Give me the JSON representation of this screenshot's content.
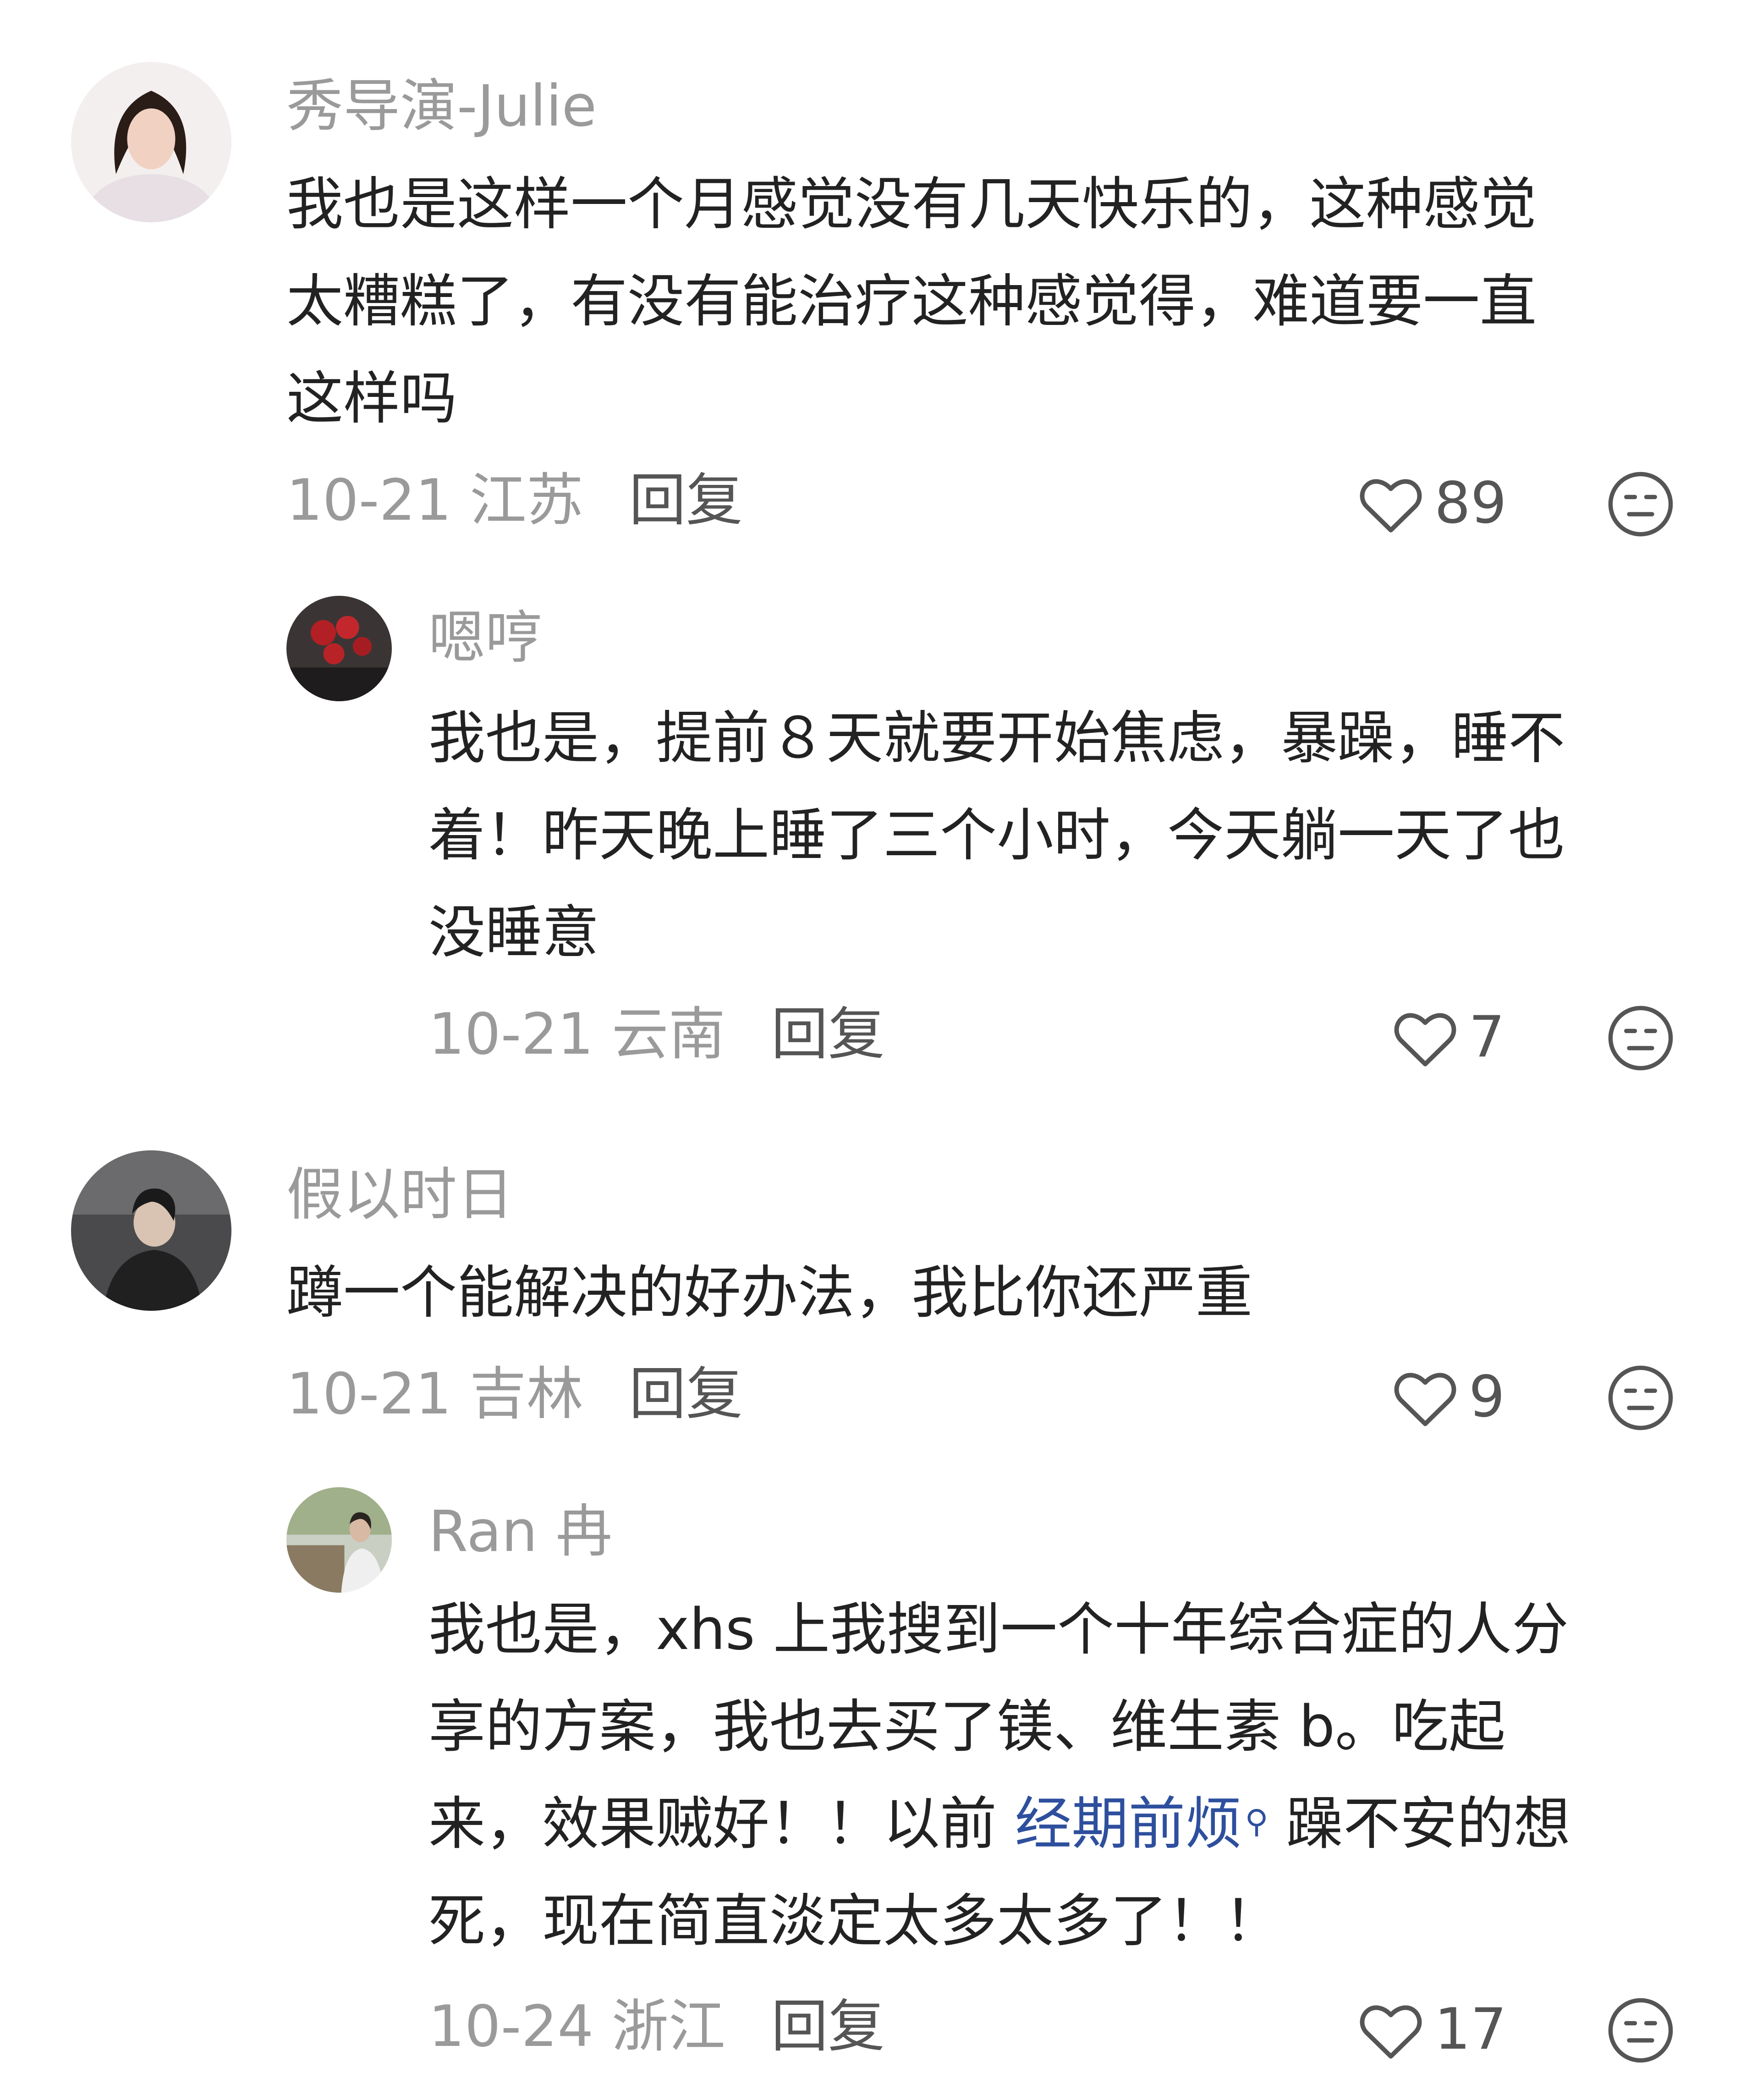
{
  "comments": [
    {
      "author": "秀导演-Julie",
      "lines": [
        "我也是这样一个月感觉没有几天快乐的，这种感觉",
        "太糟糕了，有没有能治疗这种感觉得，难道要一直",
        "这样吗"
      ],
      "date": "10-21 江苏",
      "reply": "回复",
      "likes": "89"
    },
    {
      "author": "嗯哼",
      "lines": [
        "我也是，提前８天就要开始焦虑，暴躁，睡不",
        "着！昨天晚上睡了三个小时，今天躺一天了也",
        "没睡意"
      ],
      "date": "10-21 云南",
      "reply": "回复",
      "likes": "7"
    },
    {
      "author": "假以时日",
      "lines": [
        "蹲一个能解决的好办法，我比你还严重"
      ],
      "date": "10-21 吉林",
      "reply": "回复",
      "likes": "9"
    },
    {
      "author": "Ran 冉",
      "lines": [
        "我也是，xhs 上我搜到一个十年综合症的人分",
        "享的方案，我也去买了镁、维生素 b。吃起"
      ],
      "line3_before": "来，效果贼好！！以前 ",
      "topic": "经期前烦",
      "line3_after": " 躁不安的想",
      "line4": "死，现在简直淡定太多太多了！！",
      "date": "10-24 浙江",
      "reply": "回复",
      "likes": "17"
    }
  ],
  "icons": {
    "like": "heart-outline-icon",
    "dislike": "meh-face-icon",
    "search": "search-icon"
  },
  "colors": {
    "topic_link": "#2e4f9e",
    "meta_text": "#9a9a9a"
  }
}
